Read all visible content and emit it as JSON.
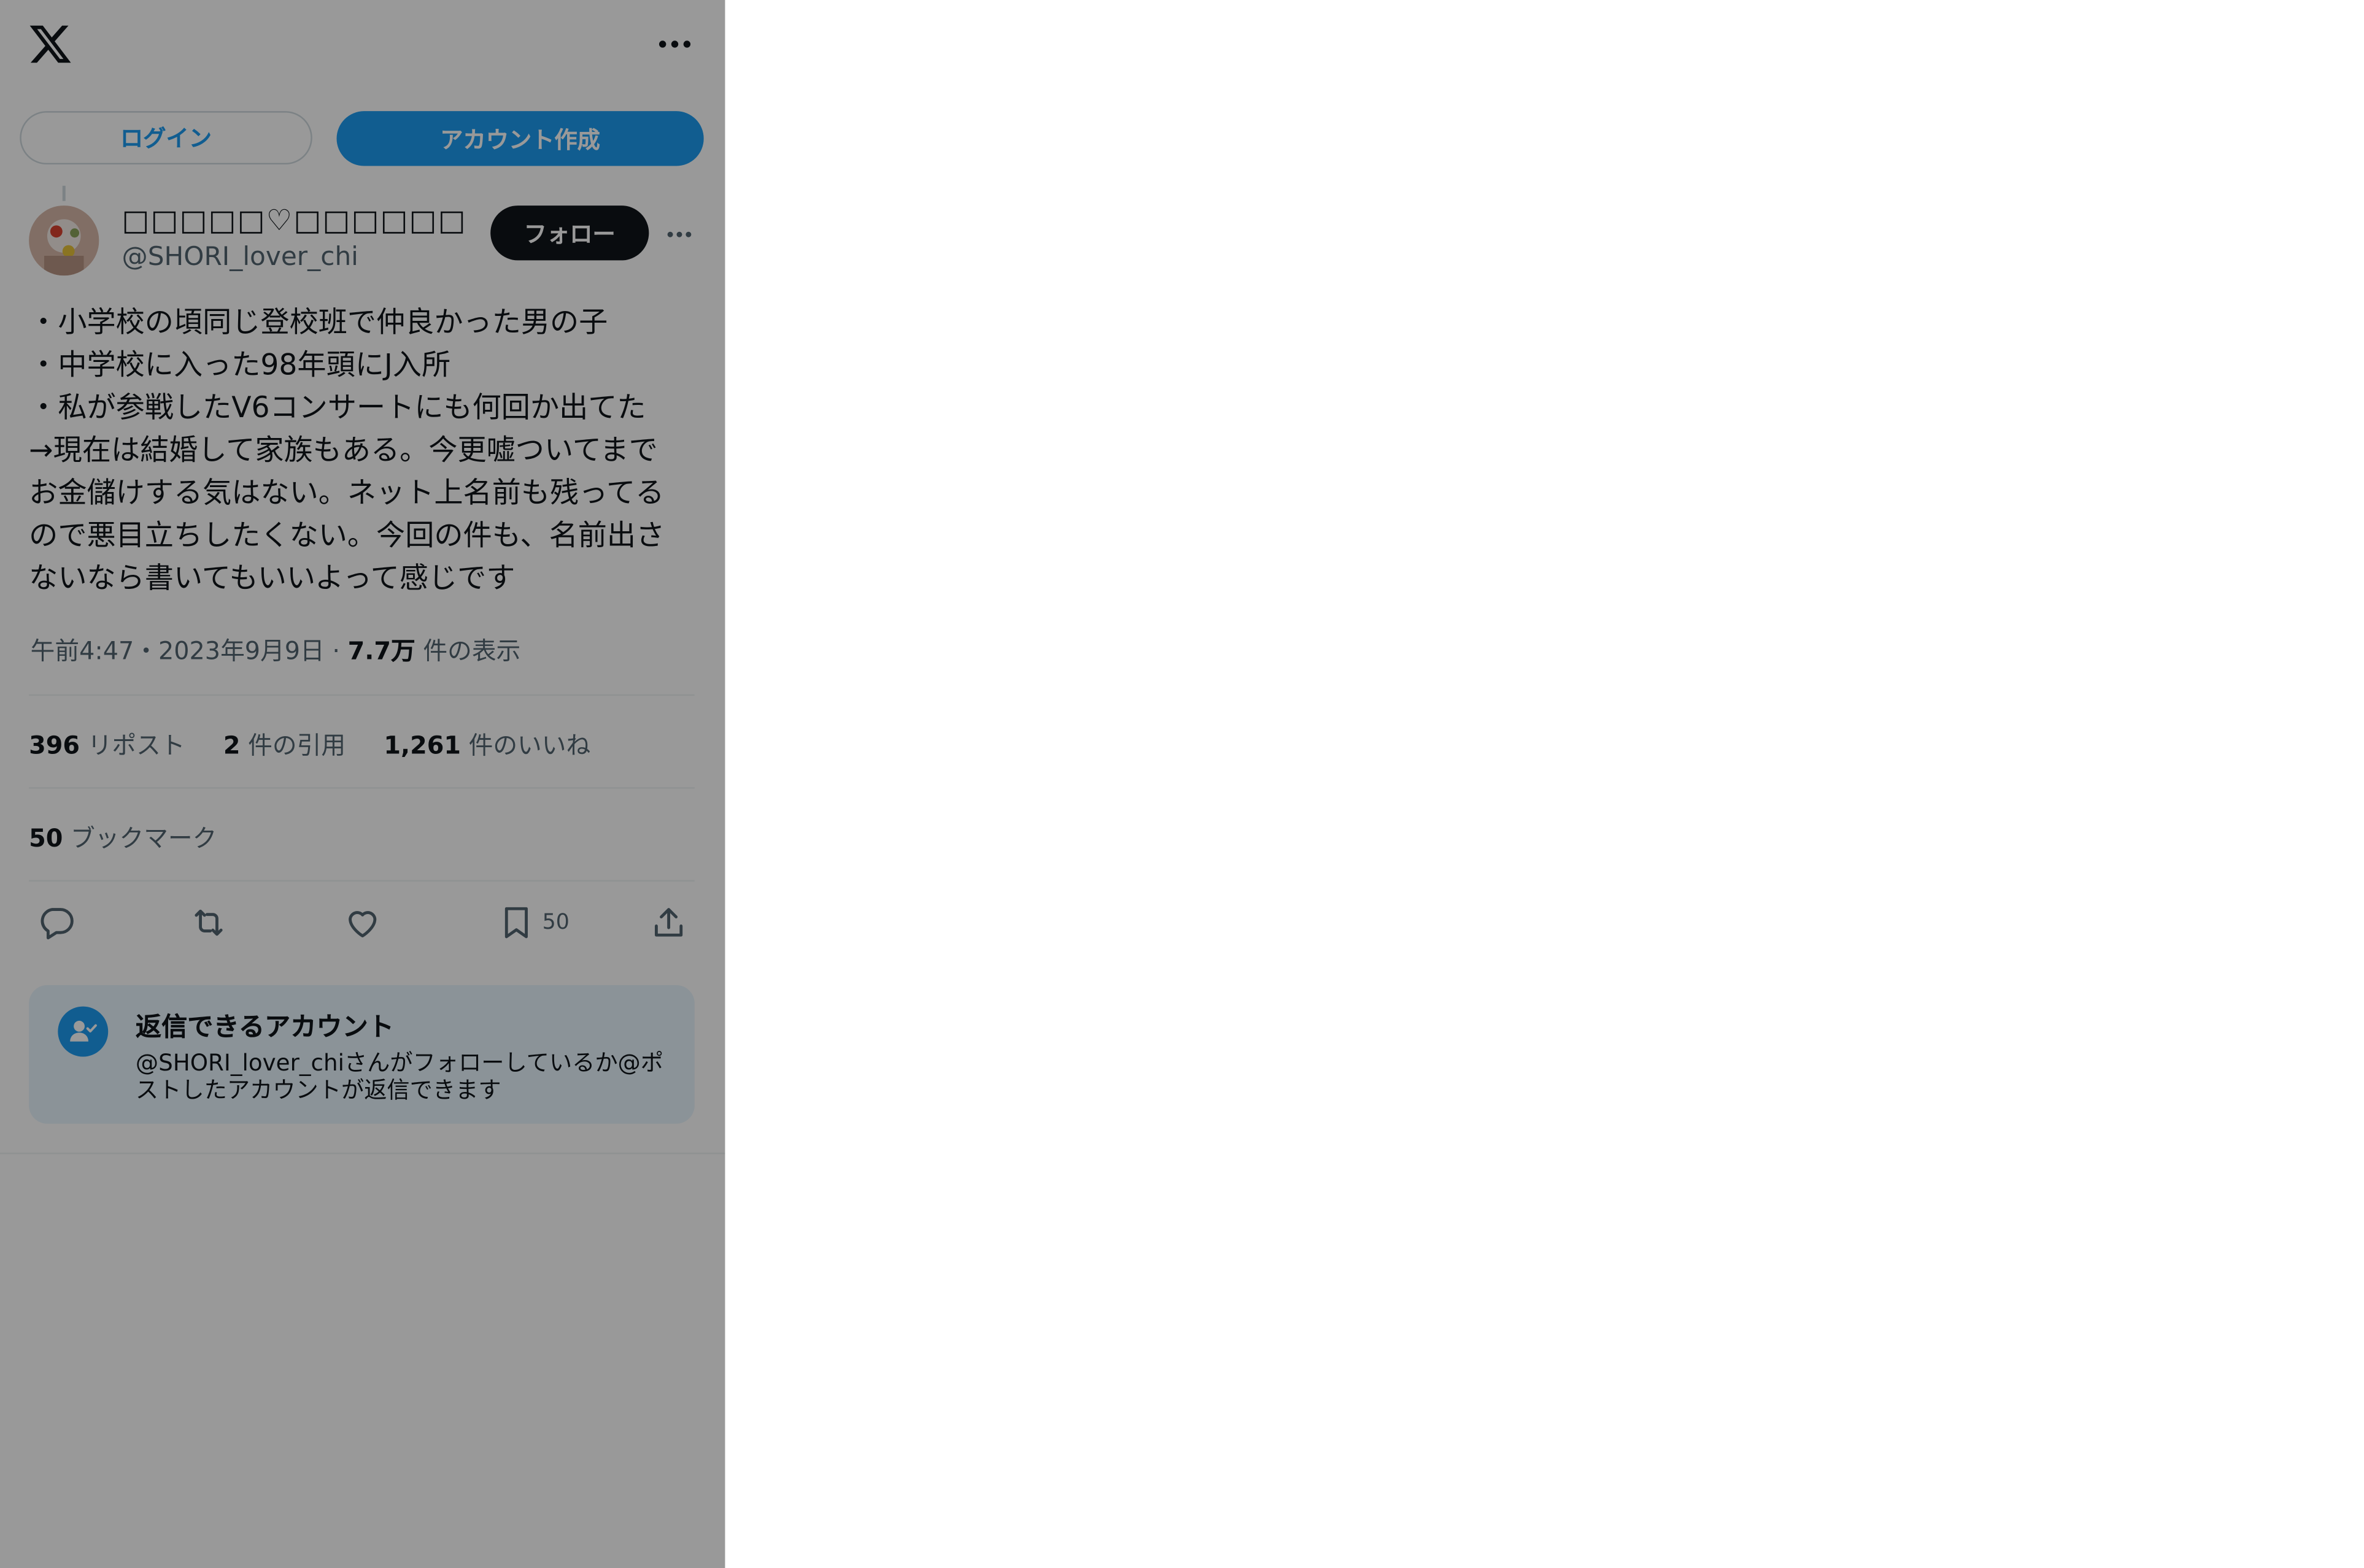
{
  "header": {
    "logo_icon": "x-logo-icon",
    "more_icon": "more-horizontal-icon",
    "login_label": "ログイン",
    "signup_label": "アカウント作成"
  },
  "tweet": {
    "display_name": "□□□□□♡□□□□□□",
    "handle": "@SHORI_lover_chi",
    "follow_label": "フォロー",
    "text_lines": [
      "・小学校の頃同じ登校班で仲良かった男の子",
      "・中学校に入った98年頭にJ入所",
      "・私が参戦したV6コンサートにも何回か出てた",
      "→現在は結婚して家族もある。今更嘘ついてまで",
      "お金儲けする気はない。ネット上名前も残ってる",
      "ので悪目立ちしたくない。今回の件も、名前出さ",
      "ないなら書いてもいいよって感じです"
    ],
    "time": "午前4:47",
    "date": "2023年9月9日",
    "views_count": "7.7万",
    "views_label": "件の表示",
    "reposts_count": "396",
    "reposts_label": "リポスト",
    "quotes_count": "2",
    "quotes_label": "件の引用",
    "likes_count": "1,261",
    "likes_label": "件のいいね",
    "bookmarks_count": "50",
    "bookmarks_label": "ブックマーク",
    "action_bookmark_count": "50"
  },
  "actions": [
    "reply-icon",
    "repost-icon",
    "like-icon",
    "bookmark-icon",
    "share-icon"
  ],
  "reply_notice": {
    "icon": "person-check-icon",
    "title": "返信できるアカウント",
    "description": "@SHORI_lover_chiさんがフォローしているか@ポストしたアカウントが返信できます"
  },
  "colors": {
    "accent": "#1d9bf0",
    "text": "#0f1419",
    "secondary": "#536471",
    "overlay": "rgba(0,0,0,0.4)"
  }
}
